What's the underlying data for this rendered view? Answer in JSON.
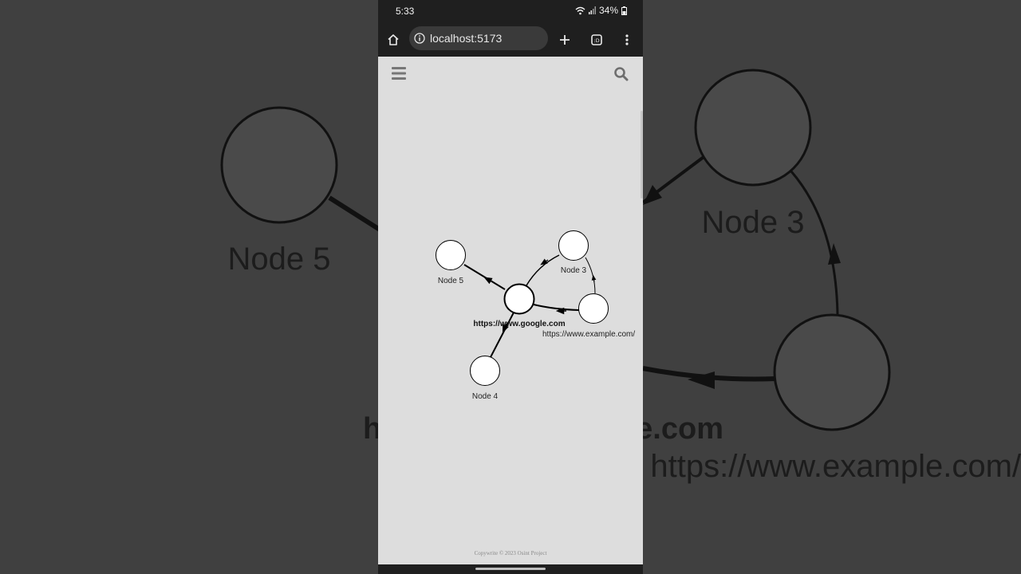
{
  "status_bar": {
    "time": "5:33",
    "battery": "34%"
  },
  "browser": {
    "url": "localhost:5173"
  },
  "icons": {
    "home": "home-icon",
    "info": "info-icon",
    "new_tab": "plus-icon",
    "tabs": "tab-switcher-icon",
    "more": "more-vert-icon",
    "menu": "hamburger-icon",
    "search": "search-icon"
  },
  "graph": {
    "nodes": [
      {
        "id": "google",
        "label": "https://www.google.com",
        "bold": true
      },
      {
        "id": "n3",
        "label": "Node 3",
        "bold": false
      },
      {
        "id": "example",
        "label": "https://www.example.com/",
        "bold": false
      },
      {
        "id": "n5",
        "label": "Node 5",
        "bold": false
      },
      {
        "id": "n4",
        "label": "Node 4",
        "bold": false
      }
    ],
    "edges": [
      {
        "from": "google",
        "to": "n5"
      },
      {
        "from": "google",
        "to": "n3"
      },
      {
        "from": "google",
        "to": "n4"
      },
      {
        "from": "example",
        "to": "google"
      },
      {
        "from": "example",
        "to": "n3"
      }
    ]
  },
  "footer": {
    "text": "Copywrite © 2023 Osint Project"
  },
  "colors": {
    "page_bg": "#dddddd",
    "chrome_bg": "#1f1f1f",
    "node_fill": "#ffffff",
    "edge": "#000000"
  }
}
